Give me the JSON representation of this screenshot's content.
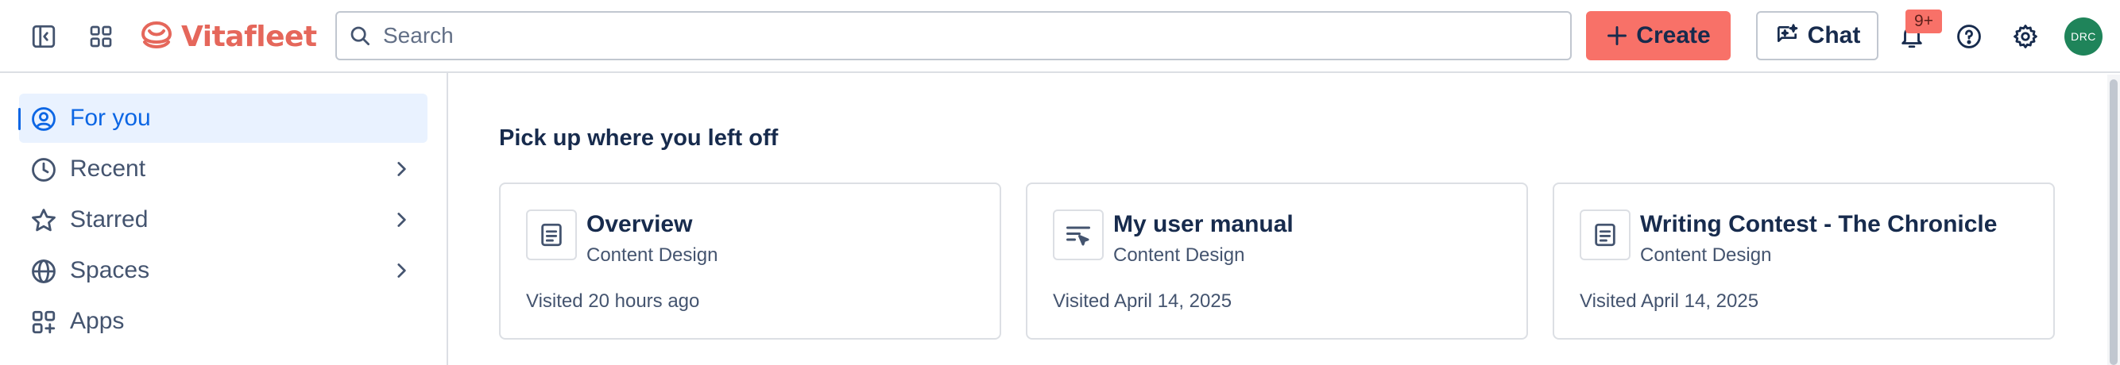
{
  "app": {
    "name": "Vitafleet"
  },
  "header": {
    "search_placeholder": "Search",
    "create_label": "Create",
    "chat_label": "Chat",
    "notifications_badge": "9+",
    "avatar_initials": "DRC"
  },
  "sidebar": {
    "items": [
      {
        "label": "For you",
        "icon": "user-circle-icon",
        "active": true
      },
      {
        "label": "Recent",
        "icon": "clock-icon",
        "expandable": true
      },
      {
        "label": "Starred",
        "icon": "star-icon",
        "expandable": true
      },
      {
        "label": "Spaces",
        "icon": "globe-icon",
        "expandable": true
      },
      {
        "label": "Apps",
        "icon": "apps-icon"
      }
    ]
  },
  "main": {
    "section_title": "Pick up where you left off",
    "cards": [
      {
        "title": "Overview",
        "space": "Content Design",
        "visited": "Visited 20 hours ago",
        "icon": "page-icon"
      },
      {
        "title": "My user manual",
        "space": "Content Design",
        "visited": "Visited April 14, 2025",
        "icon": "live-doc-icon"
      },
      {
        "title": "Writing Contest - The Chronicle",
        "space": "Content Design",
        "visited": "Visited April 14, 2025",
        "icon": "page-icon"
      }
    ]
  },
  "colors": {
    "brand": "#e5675b",
    "create_button": "#f87168",
    "active_nav_bg": "#e9f2ff",
    "active_nav_text": "#0c66e4",
    "avatar_bg": "#1f845a"
  }
}
